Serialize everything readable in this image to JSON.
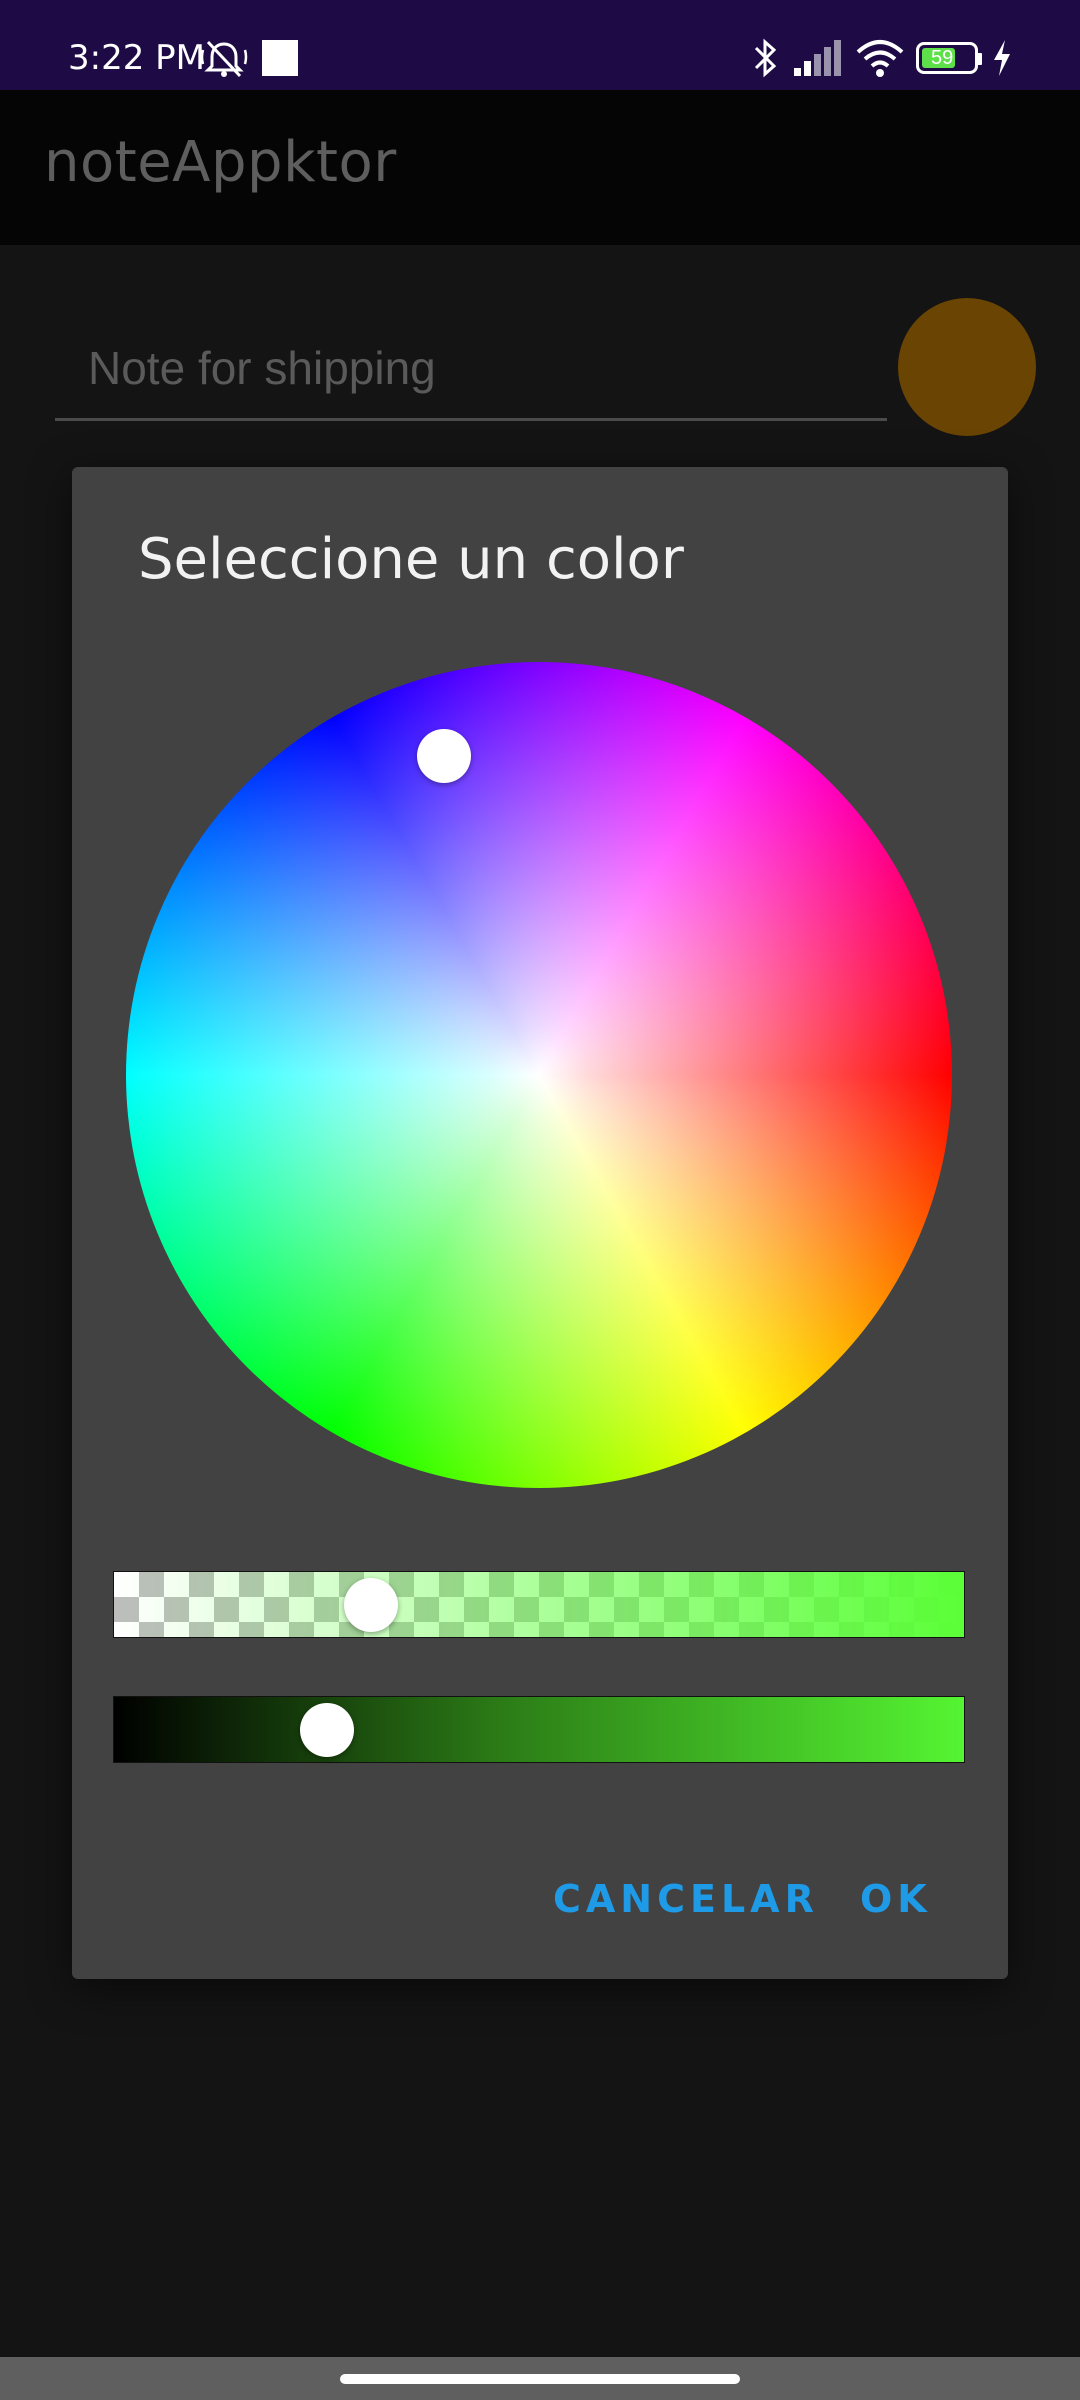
{
  "status_bar": {
    "time": "3:22 PM",
    "battery_level": "59",
    "icons": [
      "mute-bell-icon",
      "white-square-icon",
      "bluetooth-icon",
      "signal-icon",
      "wifi-icon",
      "battery-icon",
      "charging-icon"
    ]
  },
  "app_bar": {
    "title": "noteAppktor"
  },
  "note": {
    "placeholder": "Note for shipping",
    "swatch_color": "#6a4403"
  },
  "dialog": {
    "title": "Seleccione un color",
    "cancel_label": "CANCELAR",
    "ok_label": "OK",
    "selected_hue_color": "#5af537",
    "accent_color": "#1e9ae6"
  }
}
